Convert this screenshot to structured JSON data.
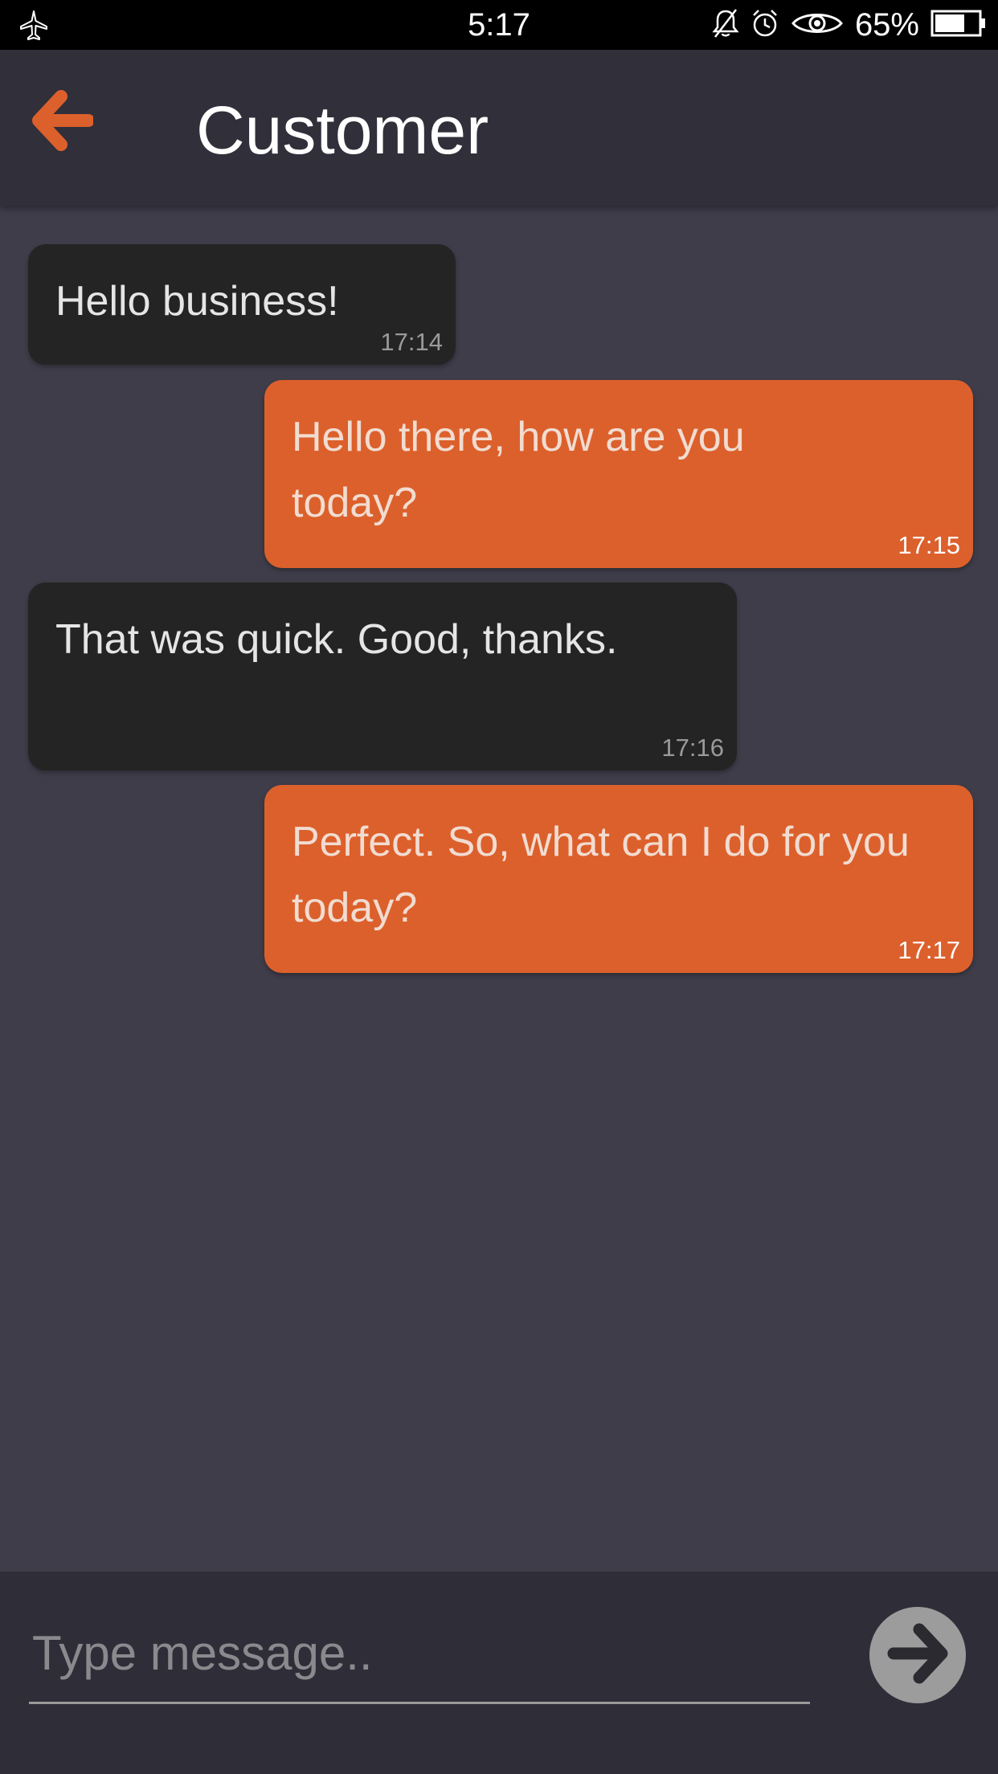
{
  "status_bar": {
    "time": "5:17",
    "battery_percent": "65%",
    "icons": [
      "airplane-icon",
      "bell-off-icon",
      "alarm-icon",
      "eye-icon",
      "battery-icon"
    ]
  },
  "header": {
    "title": "Customer",
    "back_icon": "arrow-left-icon"
  },
  "messages": [
    {
      "direction": "incoming",
      "text": "Hello business!",
      "time": "17:14"
    },
    {
      "direction": "outgoing",
      "text": "Hello there, how are you today?",
      "time": "17:15"
    },
    {
      "direction": "incoming",
      "text": "That was quick. Good, thanks.",
      "time": "17:16"
    },
    {
      "direction": "outgoing",
      "text": "Perfect. So, what can I do for you today?",
      "time": "17:17"
    }
  ],
  "composer": {
    "placeholder": "Type message..",
    "send_icon": "arrow-right-icon"
  },
  "colors": {
    "accent": "#dc602c",
    "incoming_bubble": "#242424",
    "background": "#3f3d4a",
    "header_background": "#302f3a"
  }
}
